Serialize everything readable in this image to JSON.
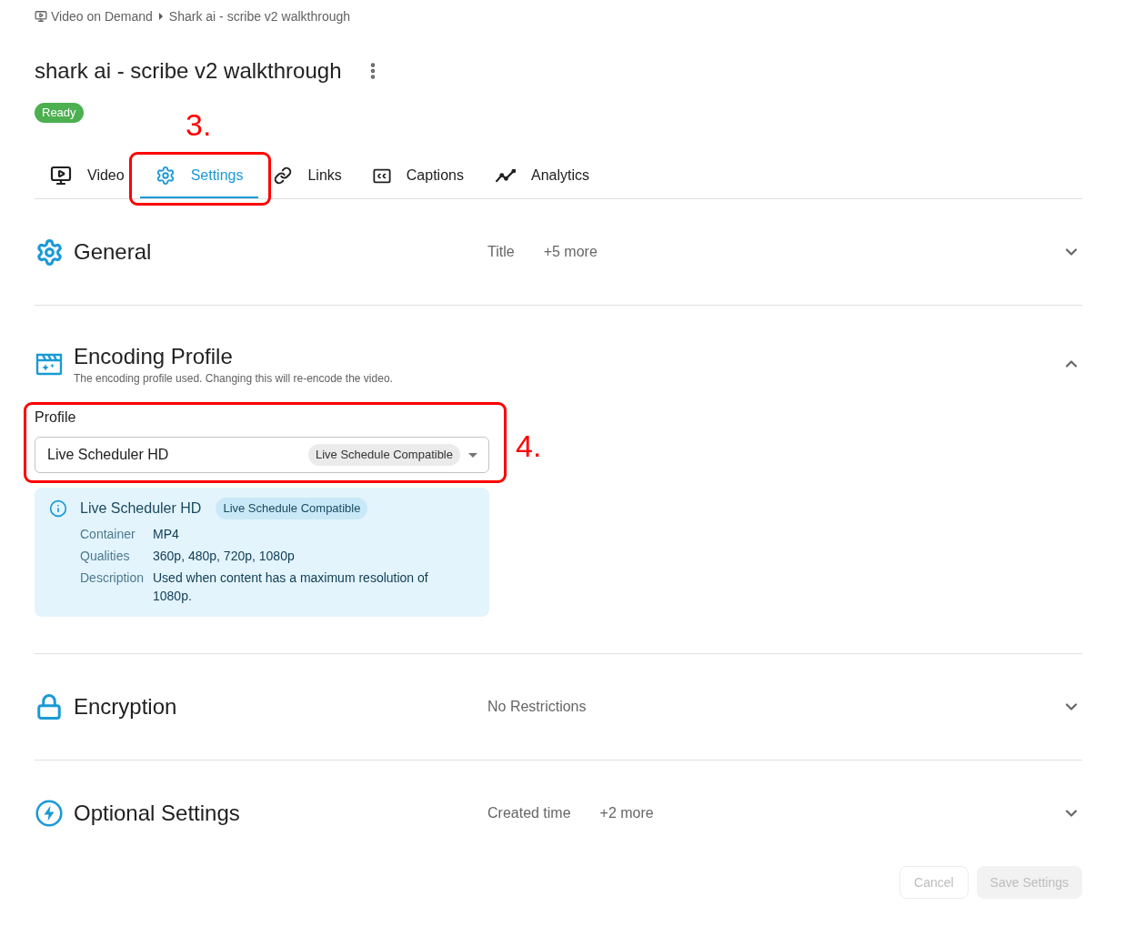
{
  "breadcrumb": [
    "Video on Demand",
    "Shark ai - scribe v2 walkthrough"
  ],
  "title": "shark ai - scribe v2 walkthrough",
  "status_badge": "Ready",
  "tabs": [
    {
      "label": "Video",
      "selected": false
    },
    {
      "label": "Settings",
      "selected": true
    },
    {
      "label": "Links",
      "selected": false
    },
    {
      "label": "Captions",
      "selected": false
    },
    {
      "label": "Analytics",
      "selected": false
    }
  ],
  "sections": [
    {
      "title": "General",
      "summary": [
        "Title",
        "+5 more"
      ],
      "expanded": false
    },
    {
      "title": "Encoding Profile",
      "subtitle": "The encoding profile used. Changing this will re-encode the video.",
      "expanded": true,
      "profile": {
        "label": "Profile",
        "value": "Live Scheduler HD",
        "tag": "Live Schedule Compatible"
      },
      "profile_info": {
        "title": "Live Scheduler HD",
        "tag": "Live Schedule Compatible",
        "details": [
          {
            "label": "Container",
            "value": "MP4"
          },
          {
            "label": "Qualities",
            "value": "360p, 480p, 720p, 1080p"
          },
          {
            "label": "Description",
            "value": "Used when content has a maximum resolution of 1080p."
          }
        ]
      }
    },
    {
      "title": "Encryption",
      "summary": [
        "No Restrictions"
      ],
      "expanded": false
    },
    {
      "title": "Optional Settings",
      "summary": [
        "Created time",
        "+2 more"
      ],
      "expanded": false
    }
  ],
  "buttons": [
    {
      "label": "Cancel",
      "kind": "secondary",
      "disabled": true
    },
    {
      "label": "Save Settings",
      "kind": "primary",
      "disabled": true
    }
  ],
  "annotations": [
    {
      "label": "3."
    },
    {
      "label": "4."
    }
  ]
}
